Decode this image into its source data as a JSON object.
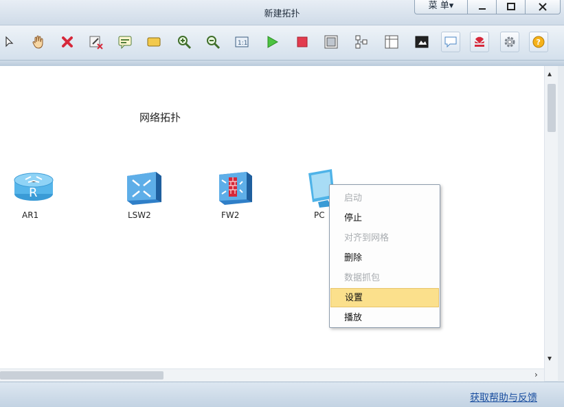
{
  "window": {
    "title": "新建拓扑",
    "menu_label": "菜 单▾"
  },
  "toolbar": {
    "icons": [
      "select-icon",
      "hand-icon",
      "delete-icon",
      "eraser-icon",
      "text-note-icon",
      "rectangle-icon",
      "zoom-in-icon",
      "zoom-out-icon",
      "fit-view-icon",
      "start-icon",
      "stop-icon",
      "capture-icon",
      "topology-icon",
      "grid-icon",
      "screen-icon",
      "chat-icon",
      "huawei-logo-icon",
      "settings-icon",
      "help-icon"
    ]
  },
  "canvas": {
    "title": "网络拓扑",
    "devices": [
      {
        "name": "AR1",
        "type": "router"
      },
      {
        "name": "LSW2",
        "type": "switch"
      },
      {
        "name": "FW2",
        "type": "firewall"
      },
      {
        "name": "PC",
        "type": "pc"
      }
    ]
  },
  "context_menu": {
    "items": [
      {
        "label": "启动",
        "enabled": false
      },
      {
        "label": "停止",
        "enabled": true
      },
      {
        "label": "对齐到网格",
        "enabled": false
      },
      {
        "label": "删除",
        "enabled": true
      },
      {
        "label": "数据抓包",
        "enabled": false
      },
      {
        "label": "设置",
        "enabled": true,
        "highlighted": true
      },
      {
        "label": "播放",
        "enabled": true
      }
    ]
  },
  "statusbar": {
    "help_link": "获取帮助与反馈"
  },
  "colors": {
    "accent_blue": "#2f7fc8",
    "menu_highlight": "#fbe08c"
  }
}
